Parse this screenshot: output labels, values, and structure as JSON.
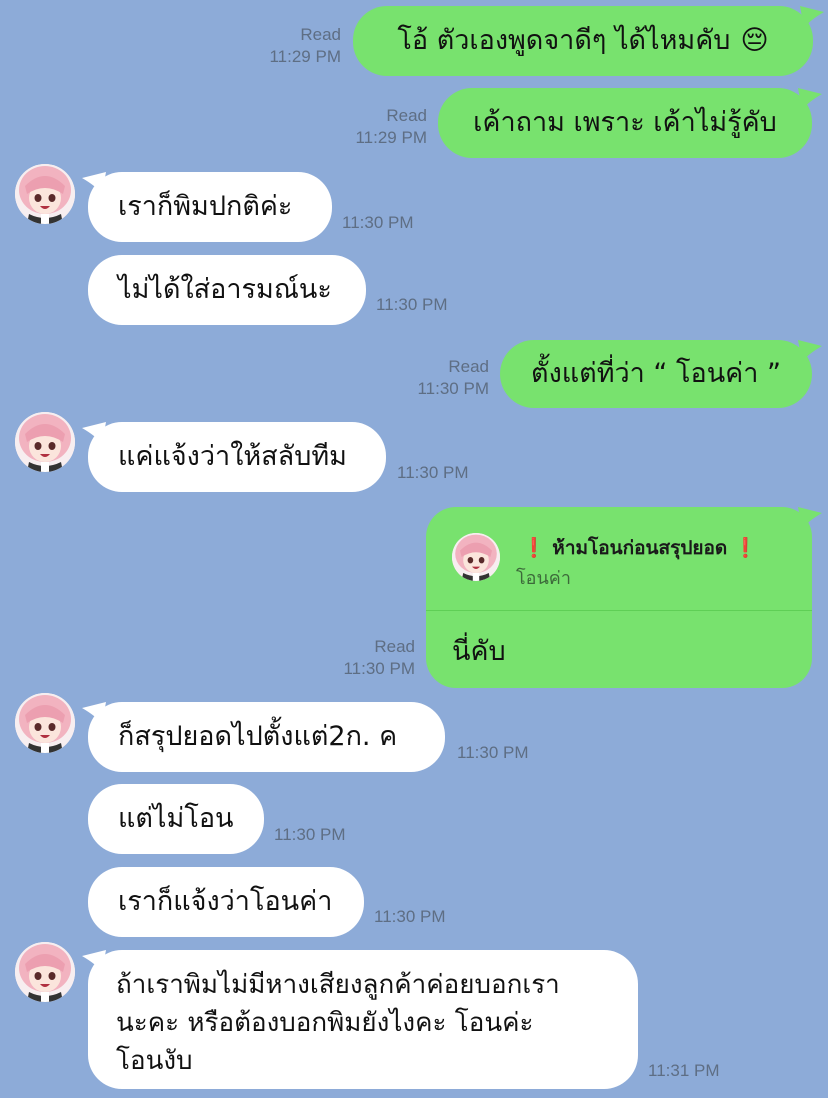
{
  "read_label": "Read",
  "colors": {
    "background": "#8dabd8",
    "outgoing_bubble": "#78e26e",
    "incoming_bubble": "#ffffff",
    "meta_text": "#5e6e84",
    "reply_divider": "#5fcf56"
  },
  "messages": [
    {
      "id": "m1",
      "dir": "out",
      "text": "โอ้ ตัวเองพูดจาดีๆ ได้ไหมคับ",
      "emoji": "😔",
      "status": "Read",
      "time": "11:29 PM"
    },
    {
      "id": "m2",
      "dir": "out",
      "text": "เค้าถาม เพราะ เค้าไม่รู้คับ",
      "status": "Read",
      "time": "11:29 PM"
    },
    {
      "id": "m3",
      "dir": "in",
      "text": "เราก็พิมปกติค่ะ",
      "time": "11:30 PM"
    },
    {
      "id": "m4",
      "dir": "in",
      "text": "ไม่ได้ใส่อารมณ์นะ",
      "time": "11:30 PM"
    },
    {
      "id": "m5",
      "dir": "out",
      "text": "ตั้งแต่ที่ว่า “ โอนค่า ”",
      "status": "Read",
      "time": "11:30 PM"
    },
    {
      "id": "m6",
      "dir": "in",
      "text": "แค่แจ้งว่าให้สลับทีม",
      "time": "11:30 PM"
    },
    {
      "id": "m7",
      "dir": "out",
      "reply": {
        "excl": "❗",
        "title": "ห้ามโอนก่อนสรุปยอด",
        "quoted": "โอนค่า"
      },
      "text": "นี่คับ",
      "status": "Read",
      "time": "11:30 PM"
    },
    {
      "id": "m8",
      "dir": "in",
      "text": "ก็สรุปยอดไปตั้งแต่2ก. ค",
      "time": "11:30 PM"
    },
    {
      "id": "m9",
      "dir": "in",
      "text": "แต่ไม่โอน",
      "time": "11:30 PM"
    },
    {
      "id": "m10",
      "dir": "in",
      "text": "เราก็แจ้งว่าโอนค่า",
      "time": "11:30 PM"
    },
    {
      "id": "m11",
      "dir": "in",
      "lines": [
        "ถ้าเราพิมไม่มีหางเสียงลูกค้าค่อยบอกเรา",
        "นะคะ หรือต้องบอกพิมยังไงคะ โอนค่ะ",
        "โอนงับ"
      ],
      "time": "11:31 PM"
    }
  ]
}
